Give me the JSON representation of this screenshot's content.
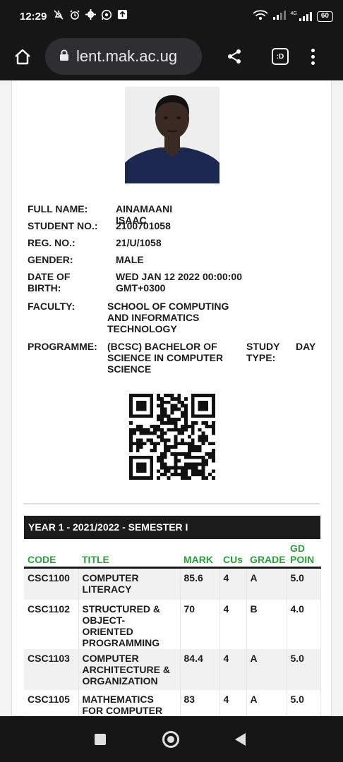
{
  "status_bar": {
    "time": "12:29",
    "battery": "60",
    "network_label": "4G"
  },
  "browser": {
    "url": "lent.mak.ac.ug",
    "tabs_label": ":D"
  },
  "student": {
    "full_name_label": "FULL NAME:",
    "full_name": "AINAMAANI ISAAC",
    "student_no_label": "STUDENT NO.:",
    "student_no": "2100701058",
    "reg_no_label": "REG. NO.:",
    "reg_no": "21/U/1058",
    "gender_label": "GENDER:",
    "gender": "MALE",
    "dob_label_1": "DATE OF",
    "dob_label_2": "BIRTH:",
    "dob_1": "WED JAN 12 2022 00:00:00",
    "dob_2": "GMT+0300",
    "faculty_label": "FACULTY:",
    "faculty_1": "SCHOOL OF COMPUTING",
    "faculty_2": "AND INFORMATICS",
    "faculty_3": "TECHNOLOGY",
    "programme_label": "PROGRAMME:",
    "programme_1": "(BCSC) BACHELOR OF",
    "programme_2": "SCIENCE IN COMPUTER",
    "programme_3": "SCIENCE",
    "study_type_label_1": "STUDY",
    "study_type_label_2": "TYPE:",
    "study_type": "DAY"
  },
  "semester": {
    "title": "YEAR 1 - 2021/2022 - SEMESTER I",
    "columns": {
      "code": "CODE",
      "title": "TITLE",
      "mark": "MARK",
      "cus": "CUs",
      "grade": "GRADE",
      "gd_1": "GD",
      "gd_2": "POIN"
    },
    "rows": [
      {
        "code": "CSC1100",
        "title_lines": [
          "COMPUTER",
          "LITERACY"
        ],
        "mark": "85.6",
        "cus": "4",
        "grade": "A",
        "gd": "5.0"
      },
      {
        "code": "CSC1102",
        "title_lines": [
          "STRUCTURED &",
          "OBJECT-",
          "ORIENTED",
          "PROGRAMMING"
        ],
        "mark": "70",
        "cus": "4",
        "grade": "B",
        "gd": "4.0"
      },
      {
        "code": "CSC1103",
        "title_lines": [
          "COMPUTER",
          "ARCHITECTURE &",
          "ORGANIZATION"
        ],
        "mark": "84.4",
        "cus": "4",
        "grade": "A",
        "gd": "5.0"
      },
      {
        "code": "CSC1105",
        "title_lines": [
          "MATHEMATICS",
          "FOR COMPUTER"
        ],
        "mark": "83",
        "cus": "4",
        "grade": "A",
        "gd": "5.0"
      }
    ]
  },
  "colors": {
    "header_green": "#2e9e3e",
    "semester_bar": "#1b1b1b",
    "chrome_dark": "#161616"
  }
}
